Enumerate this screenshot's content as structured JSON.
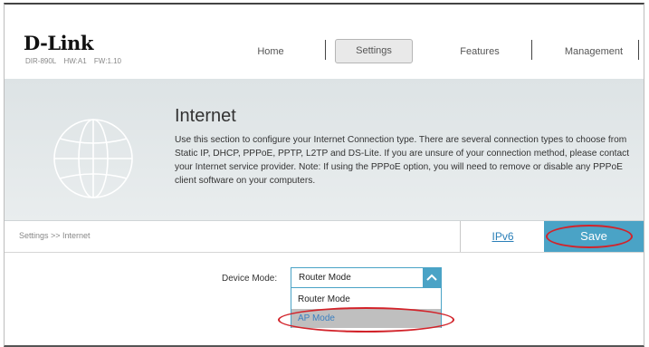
{
  "header": {
    "logo": "D-Link",
    "model": "DIR-890L",
    "hw": "HW:A1",
    "fw": "FW:1.10",
    "nav": {
      "home": "Home",
      "settings": "Settings",
      "features": "Features",
      "management": "Management"
    }
  },
  "banner": {
    "title": "Internet",
    "description": "Use this section to configure your Internet Connection type. There are several connection types to choose from Static IP, DHCP, PPPoE, PPTP, L2TP and DS-Lite. If you are unsure of your connection method, please contact your Internet service provider. Note: If using the PPPoE option, you will need to remove or disable any PPPoE client software on your computers."
  },
  "toolbar": {
    "breadcrumb": "Settings >> Internet",
    "ipv6_label": "IPv6",
    "save_label": "Save"
  },
  "form": {
    "device_mode_label": "Device Mode:",
    "device_mode_value": "Router Mode",
    "options": [
      "Router Mode",
      "AP Mode"
    ],
    "highlighted_option": "AP Mode"
  },
  "colors": {
    "accent": "#4aa3c6",
    "highlight_ring": "#d2232a",
    "banner_bg": "#e3e8ea"
  },
  "icons": {
    "banner_icon": "globe-icon",
    "select_button": "chevron-up-icon"
  }
}
